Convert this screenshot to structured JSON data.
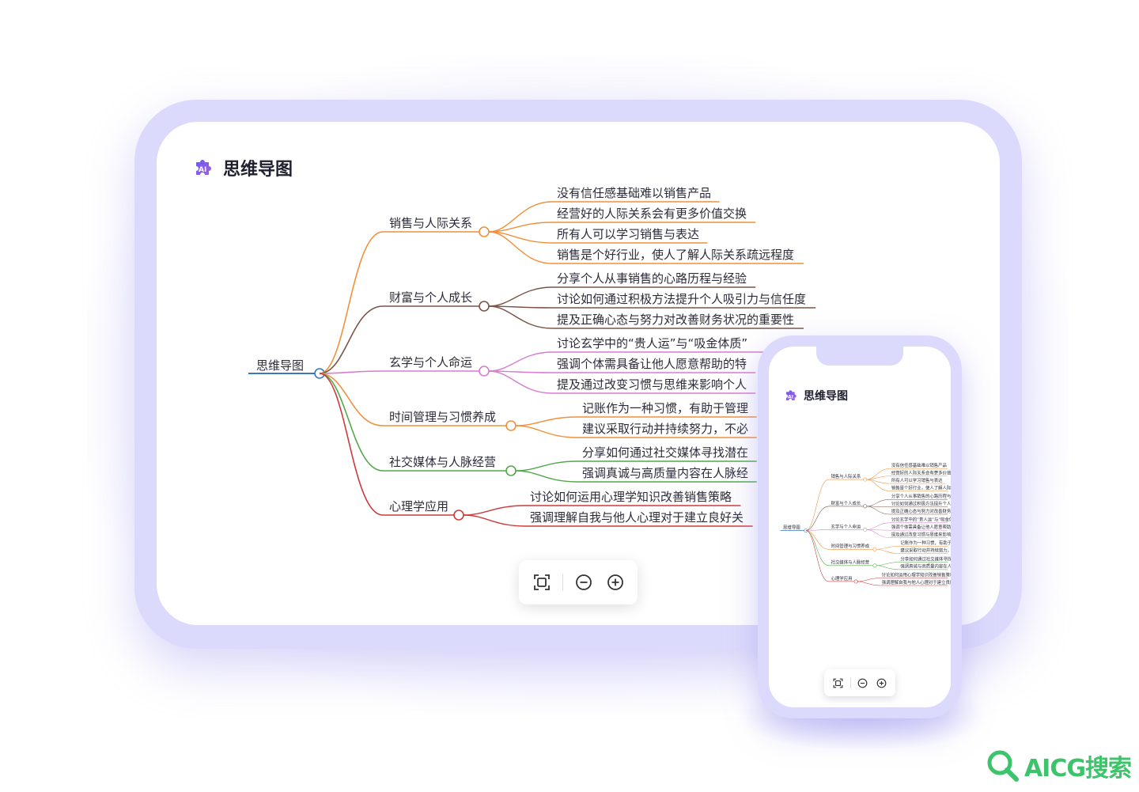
{
  "app": {
    "title": "思维导图"
  },
  "mindmap": {
    "root": "思维导图",
    "branches": [
      {
        "label": "销售与人际关系",
        "color": "#f0913c",
        "children": [
          "没有信任感基础难以销售产品",
          "经营好的人际关系会有更多价值交换",
          "所有人可以学习销售与表达",
          "销售是个好行业，使人了解人际关系疏远程度"
        ]
      },
      {
        "label": "财富与个人成长",
        "color": "#7a5548",
        "children": [
          "分享个人从事销售的心路历程与经验",
          "讨论如何通过积极方法提升个人吸引力与信任度",
          "提及正确心态与努力对改善财务状况的重要性"
        ]
      },
      {
        "label": "玄学与个人命运",
        "color": "#d97ccf",
        "children": [
          "讨论玄学中的“贵人运”与“吸金体质”",
          "强调个体需具备让他人愿意帮助的特",
          "提及通过改变习惯与思维来影响个人"
        ]
      },
      {
        "label": "时间管理与习惯养成",
        "color": "#f0913c",
        "children": [
          "记账作为一种习惯，有助于管理",
          "建议采取行动并持续努力，不必"
        ]
      },
      {
        "label": "社交媒体与人脉经营",
        "color": "#52a84a",
        "children": [
          "分享如何通过社交媒体寻找潜在",
          "强调真诚与高质量内容在人脉经"
        ]
      },
      {
        "label": "心理学应用",
        "color": "#cc3b3b",
        "children": [
          "讨论如何运用心理学知识改善销售策略",
          "强调理解自我与他人心理对于建立良好关"
        ]
      }
    ],
    "root_color": "#3a78c2"
  },
  "toolbar": {
    "fit_icon": "fit-screen-icon",
    "zoom_out_icon": "zoom-out-icon",
    "zoom_in_icon": "zoom-in-icon"
  },
  "phone": {
    "title": "思维导图"
  },
  "watermark": {
    "text": "AICG搜索"
  }
}
